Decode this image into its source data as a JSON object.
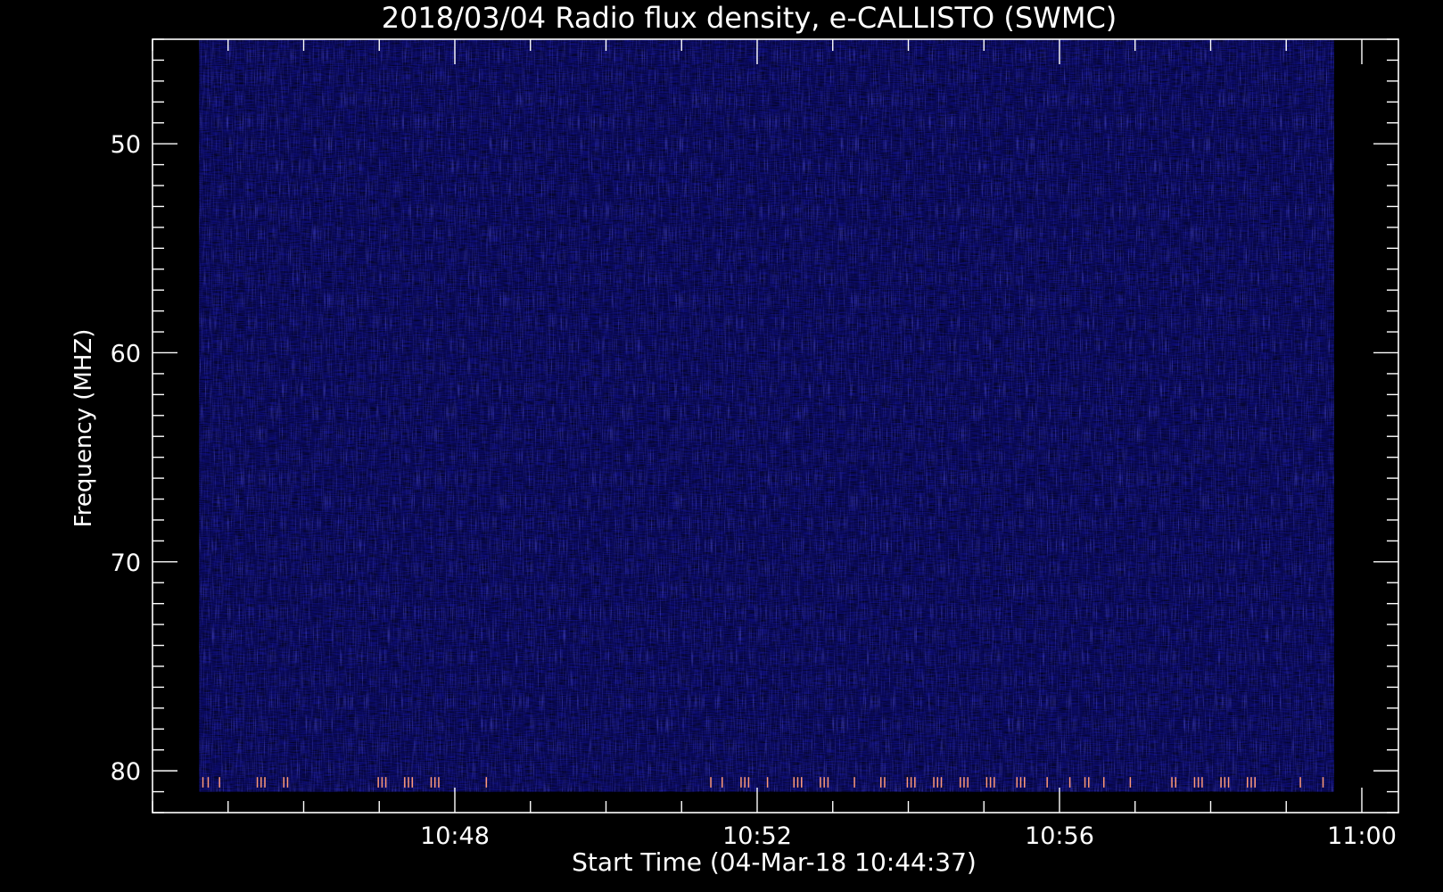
{
  "chart_data": {
    "type": "heatmap",
    "title": "2018/03/04  Radio flux density, e-CALLISTO (SWMC)",
    "xlabel": "Start Time (04-Mar-18 10:44:37)",
    "ylabel": "Frequency (MHZ)",
    "x_unit": "minutes after 10:44:37 UT",
    "xlim": [
      -0.617,
      15.867
    ],
    "x_data_range": [
      0,
      15.017
    ],
    "ylim": [
      45,
      82
    ],
    "y_inverted": true,
    "y_data_range": [
      45,
      81
    ],
    "x_ticks": [
      {
        "value": 3.383,
        "label": "10:48"
      },
      {
        "value": 7.383,
        "label": "10:52"
      },
      {
        "value": 11.383,
        "label": "10:56"
      },
      {
        "value": 15.383,
        "label": "11:00"
      }
    ],
    "x_minor_tick_step": 1,
    "y_ticks": [
      {
        "value": 50,
        "label": "50"
      },
      {
        "value": 60,
        "label": "60"
      },
      {
        "value": 70,
        "label": "70"
      },
      {
        "value": 80,
        "label": "80"
      }
    ],
    "y_minor_tick_step": 1,
    "grid": false,
    "colormap": "dark blue to black noise",
    "background_intensity": "low (uniform noise)",
    "rfi_spikes": {
      "frequency_range_mhz": [
        80.3,
        80.8
      ],
      "times_min": [
        0.05,
        0.12,
        0.27,
        0.77,
        0.82,
        0.87,
        1.12,
        1.17,
        2.37,
        2.42,
        2.47,
        2.72,
        2.77,
        2.82,
        3.07,
        3.12,
        3.17,
        3.8,
        6.77,
        6.92,
        7.17,
        7.22,
        7.27,
        7.52,
        7.87,
        7.92,
        7.97,
        8.22,
        8.27,
        8.32,
        8.67,
        9.02,
        9.07,
        9.37,
        9.42,
        9.47,
        9.72,
        9.77,
        9.82,
        10.07,
        10.12,
        10.17,
        10.42,
        10.47,
        10.52,
        10.82,
        10.87,
        10.92,
        11.22,
        11.52,
        11.72,
        11.77,
        11.97,
        12.32,
        12.87,
        12.92,
        13.17,
        13.22,
        13.27,
        13.52,
        13.57,
        13.62,
        13.87,
        13.92,
        13.97,
        14.57,
        14.87
      ],
      "color": "#ff9a7a"
    },
    "colors": {
      "background": "#000000",
      "axes": "#ffffff",
      "data_base": "#0c0c72"
    }
  }
}
